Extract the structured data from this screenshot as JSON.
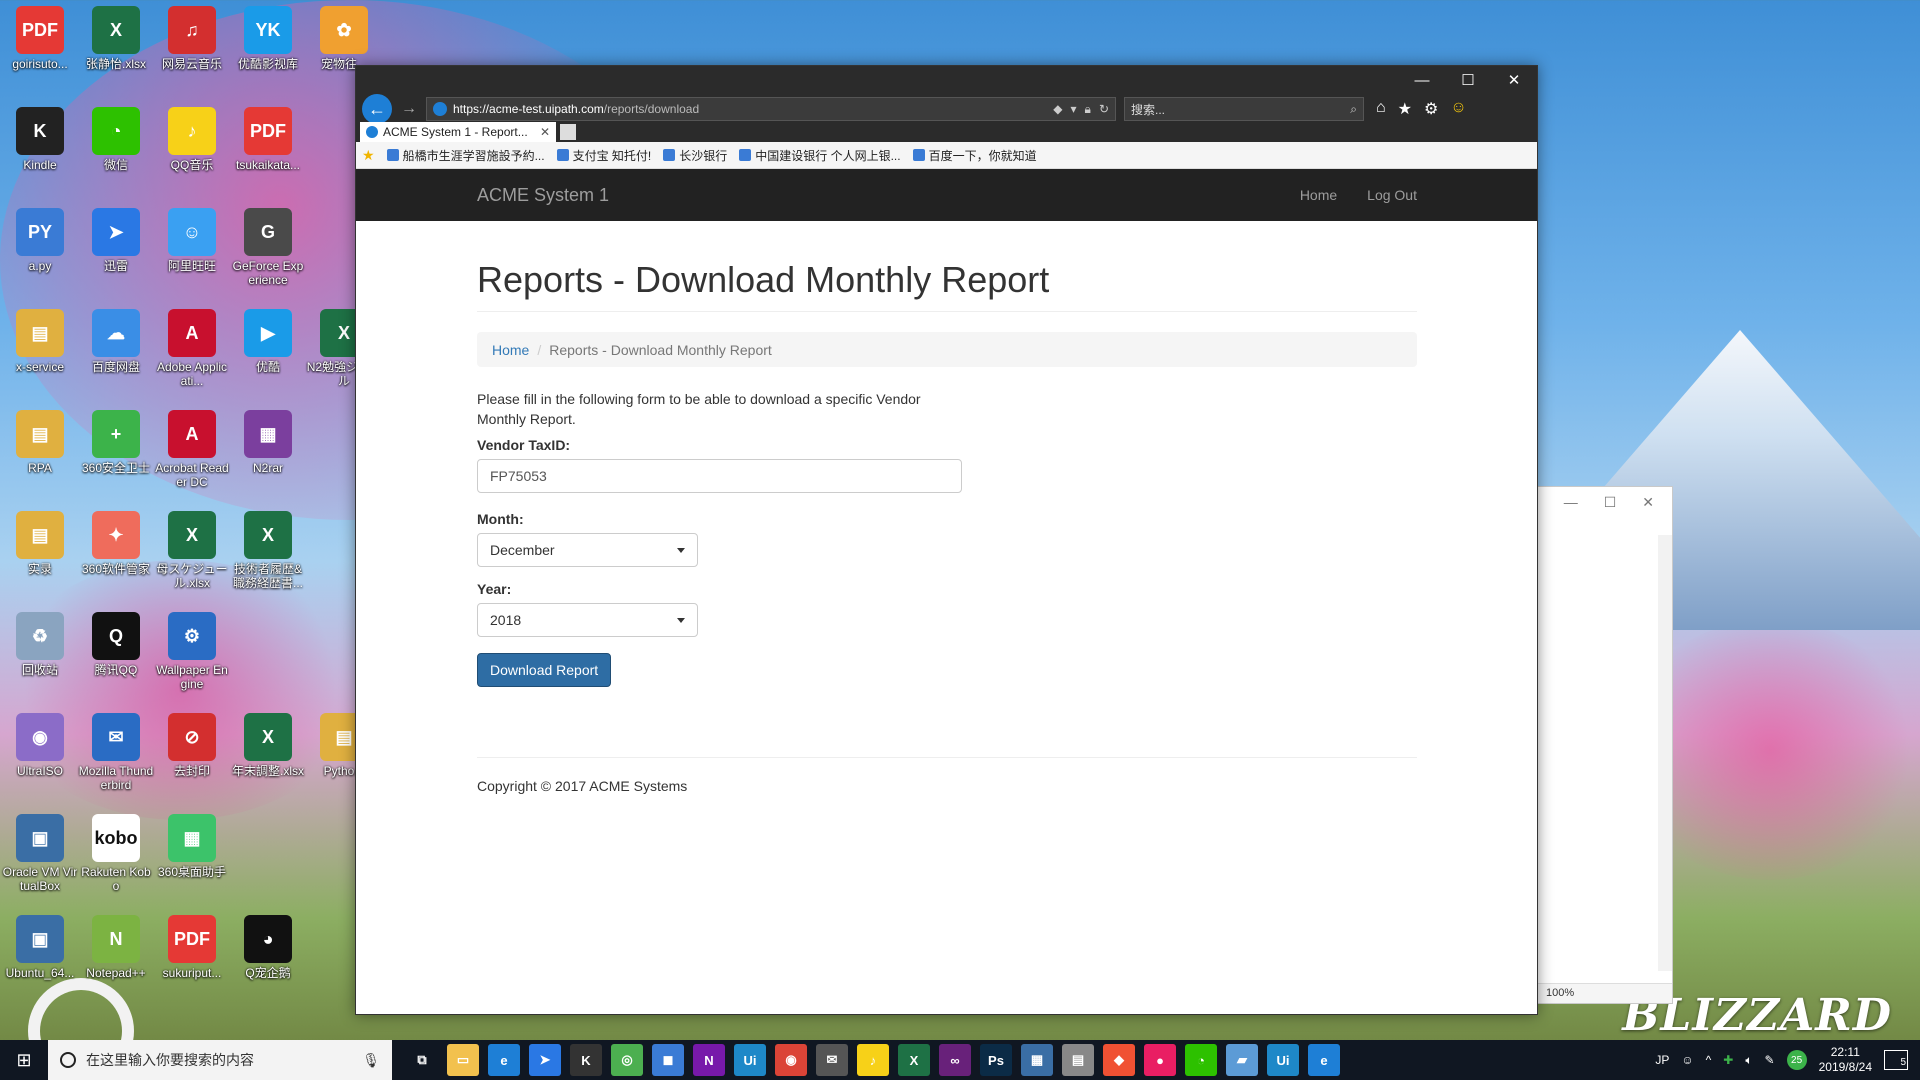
{
  "desktop": {
    "icons": [
      {
        "label": "goirisuto...",
        "glyph": "PDF",
        "color": "#e53935",
        "col": 0,
        "row": 0
      },
      {
        "label": "张静怡.xlsx",
        "glyph": "X",
        "color": "#1e7145",
        "col": 1,
        "row": 0
      },
      {
        "label": "网易云音乐",
        "glyph": "♫",
        "color": "#d32f2f",
        "col": 2,
        "row": 0
      },
      {
        "label": "优酷影视库",
        "glyph": "YK",
        "color": "#1a9be8",
        "col": 3,
        "row": 0
      },
      {
        "label": "宠物往...",
        "glyph": "✿",
        "color": "#f0a030",
        "col": 4,
        "row": 0
      },
      {
        "label": "Kindle",
        "glyph": "K",
        "color": "#222222",
        "col": 0,
        "row": 1
      },
      {
        "label": "微信",
        "glyph": "◔",
        "color": "#2dc100",
        "col": 1,
        "row": 1
      },
      {
        "label": "QQ音乐",
        "glyph": "♪",
        "color": "#f7d118",
        "col": 2,
        "row": 1
      },
      {
        "label": "tsukaikata...",
        "glyph": "PDF",
        "color": "#e53935",
        "col": 3,
        "row": 1
      },
      {
        "label": "a.py",
        "glyph": "PY",
        "color": "#3a7bd5",
        "col": 0,
        "row": 2
      },
      {
        "label": "迅雷",
        "glyph": "➤",
        "color": "#2a78e4",
        "col": 1,
        "row": 2
      },
      {
        "label": "阿里旺旺",
        "glyph": "☺",
        "color": "#3aa0f2",
        "col": 2,
        "row": 2
      },
      {
        "label": "GeForce Experience",
        "glyph": "G",
        "color": "#4a4a4a",
        "col": 3,
        "row": 2
      },
      {
        "label": "x-service",
        "glyph": "▤",
        "color": "#e0b040",
        "col": 0,
        "row": 3
      },
      {
        "label": "百度网盘",
        "glyph": "☁",
        "color": "#3a8ee6",
        "col": 1,
        "row": 3
      },
      {
        "label": "Adobe Applicati...",
        "glyph": "A",
        "color": "#c8102e",
        "col": 2,
        "row": 3
      },
      {
        "label": "优酷",
        "glyph": "▶",
        "color": "#1a9be8",
        "col": 3,
        "row": 3
      },
      {
        "label": "N2勉強ジュール",
        "glyph": "X",
        "color": "#1e7145",
        "col": 4,
        "row": 3
      },
      {
        "label": "RPA",
        "glyph": "▤",
        "color": "#e0b040",
        "col": 0,
        "row": 4
      },
      {
        "label": "360安全卫士",
        "glyph": "+",
        "color": "#3cb34a",
        "col": 1,
        "row": 4
      },
      {
        "label": "Acrobat Reader DC",
        "glyph": "A",
        "color": "#c8102e",
        "col": 2,
        "row": 4
      },
      {
        "label": "N2rar",
        "glyph": "▦",
        "color": "#7b3f9e",
        "col": 3,
        "row": 4
      },
      {
        "label": "实录",
        "glyph": "▤",
        "color": "#e0b040",
        "col": 0,
        "row": 5
      },
      {
        "label": "360软件管家",
        "glyph": "✦",
        "color": "#ef6c5c",
        "col": 1,
        "row": 5
      },
      {
        "label": "母スケジュール.xlsx",
        "glyph": "X",
        "color": "#1e7145",
        "col": 2,
        "row": 5
      },
      {
        "label": "技術者履歴&職務経歴書...",
        "glyph": "X",
        "color": "#1e7145",
        "col": 3,
        "row": 5
      },
      {
        "label": "回收站",
        "glyph": "♻",
        "color": "#8aa4c0",
        "col": 0,
        "row": 6
      },
      {
        "label": "腾讯QQ",
        "glyph": "Q",
        "color": "#111111",
        "col": 1,
        "row": 6
      },
      {
        "label": "Wallpaper Engine",
        "glyph": "⚙",
        "color": "#2a6cc4",
        "col": 2,
        "row": 6
      },
      {
        "label": "UltraISO",
        "glyph": "◉",
        "color": "#8b6cc8",
        "col": 0,
        "row": 7
      },
      {
        "label": "Mozilla Thunderbird",
        "glyph": "✉",
        "color": "#2a6cc4",
        "col": 1,
        "row": 7
      },
      {
        "label": "去封印",
        "glyph": "⊘",
        "color": "#d32f2f",
        "col": 2,
        "row": 7
      },
      {
        "label": "年末調整.xlsx",
        "glyph": "X",
        "color": "#1e7145",
        "col": 3,
        "row": 7
      },
      {
        "label": "Pytho...",
        "glyph": "▤",
        "color": "#e0b040",
        "col": 4,
        "row": 7
      },
      {
        "label": "Oracle VM VirtualBox",
        "glyph": "▣",
        "color": "#3a6ea5",
        "col": 0,
        "row": 8
      },
      {
        "label": "Rakuten Kobo",
        "glyph": "kobo",
        "color": "#ffffff",
        "col": 1,
        "row": 8
      },
      {
        "label": "360桌面助手",
        "glyph": "▦",
        "color": "#3cc36a",
        "col": 2,
        "row": 8
      },
      {
        "label": "Ubuntu_64...",
        "glyph": "▣",
        "color": "#3a6ea5",
        "col": 0,
        "row": 9
      },
      {
        "label": "Notepad++",
        "glyph": "N",
        "color": "#7cb342",
        "col": 1,
        "row": 9
      },
      {
        "label": "sukuriput...",
        "glyph": "PDF",
        "color": "#e53935",
        "col": 2,
        "row": 9
      },
      {
        "label": "Q宠企鹅",
        "glyph": "◕",
        "color": "#111111",
        "col": 3,
        "row": 9
      }
    ],
    "wallpaper_brand": "BLIZZARD"
  },
  "second_window": {
    "minimize": "—",
    "maximize": "☐",
    "close": "✕",
    "zoom": "100%"
  },
  "browser": {
    "window_controls": {
      "minimize": "—",
      "maximize": "☐",
      "close": "✕"
    },
    "back": "←",
    "forward": "→",
    "url_host": "https://acme-test.uipath.com",
    "url_path": "/reports/download",
    "search_placeholder": "搜索...",
    "search_icon": "⌕",
    "tools": [
      "⌂",
      "★",
      "⚙",
      "☺"
    ],
    "tab_title": "ACME System 1 - Report...",
    "tab_close": "✕",
    "favorites": [
      "船橋市生涯学習施設予約...",
      "支付宝 知托付!",
      "长沙银行",
      "中国建设银行 个人网上银...",
      "百度一下，你就知道"
    ]
  },
  "site": {
    "brand": "ACME System 1",
    "nav": {
      "home": "Home",
      "logout": "Log Out"
    },
    "title": "Reports - Download Monthly Report",
    "breadcrumb": {
      "home": "Home",
      "current": "Reports - Download Monthly Report"
    },
    "intro": "Please fill in the following form to be able to download a specific Vendor Monthly Report.",
    "form": {
      "vendor_label": "Vendor TaxID:",
      "vendor_value": "FP75053",
      "month_label": "Month:",
      "month_value": "December",
      "year_label": "Year:",
      "year_value": "2018",
      "submit": "Download Report"
    },
    "footer": "Copyright © 2017 ACME Systems"
  },
  "taskbar": {
    "search_placeholder": "在这里输入你要搜索的内容",
    "apps": [
      {
        "name": "task-view",
        "glyph": "⧉",
        "color": "transparent"
      },
      {
        "name": "file-explorer",
        "glyph": "▭",
        "color": "#f2c14e"
      },
      {
        "name": "edge",
        "glyph": "e",
        "color": "#1e7fd6"
      },
      {
        "name": "thunder",
        "glyph": "➤",
        "color": "#2a78e4"
      },
      {
        "name": "kindle",
        "glyph": "K",
        "color": "#333333"
      },
      {
        "name": "app-green",
        "glyph": "◎",
        "color": "#4caf50"
      },
      {
        "name": "app-blue",
        "glyph": "◼",
        "color": "#3a7bd5"
      },
      {
        "name": "onenote",
        "glyph": "N",
        "color": "#7719aa"
      },
      {
        "name": "uipath",
        "glyph": "Ui",
        "color": "#1e88c8"
      },
      {
        "name": "chrome",
        "glyph": "◉",
        "color": "#db4437"
      },
      {
        "name": "mail",
        "glyph": "✉",
        "color": "#555555"
      },
      {
        "name": "qq-music",
        "glyph": "♪",
        "color": "#f7d118"
      },
      {
        "name": "excel",
        "glyph": "X",
        "color": "#1e7145"
      },
      {
        "name": "visual-studio",
        "glyph": "∞",
        "color": "#68217a"
      },
      {
        "name": "photoshop",
        "glyph": "Ps",
        "color": "#0b2b46"
      },
      {
        "name": "app-remote",
        "glyph": "▦",
        "color": "#3a6ea5"
      },
      {
        "name": "app-doc",
        "glyph": "▤",
        "color": "#888888"
      },
      {
        "name": "git",
        "glyph": "◆",
        "color": "#f05133"
      },
      {
        "name": "app-balloon",
        "glyph": "●",
        "color": "#e91e63"
      },
      {
        "name": "wechat",
        "glyph": "◔",
        "color": "#2dc100"
      },
      {
        "name": "app-clip",
        "glyph": "▰",
        "color": "#5c9bd6"
      },
      {
        "name": "uipath-studio",
        "glyph": "Ui",
        "color": "#1e88c8"
      },
      {
        "name": "internet-explorer",
        "glyph": "e",
        "color": "#1e7fd6"
      }
    ],
    "tray_text": "JP",
    "time": "22:11",
    "date": "2019/8/24",
    "badge": "25",
    "notifications": "5"
  }
}
